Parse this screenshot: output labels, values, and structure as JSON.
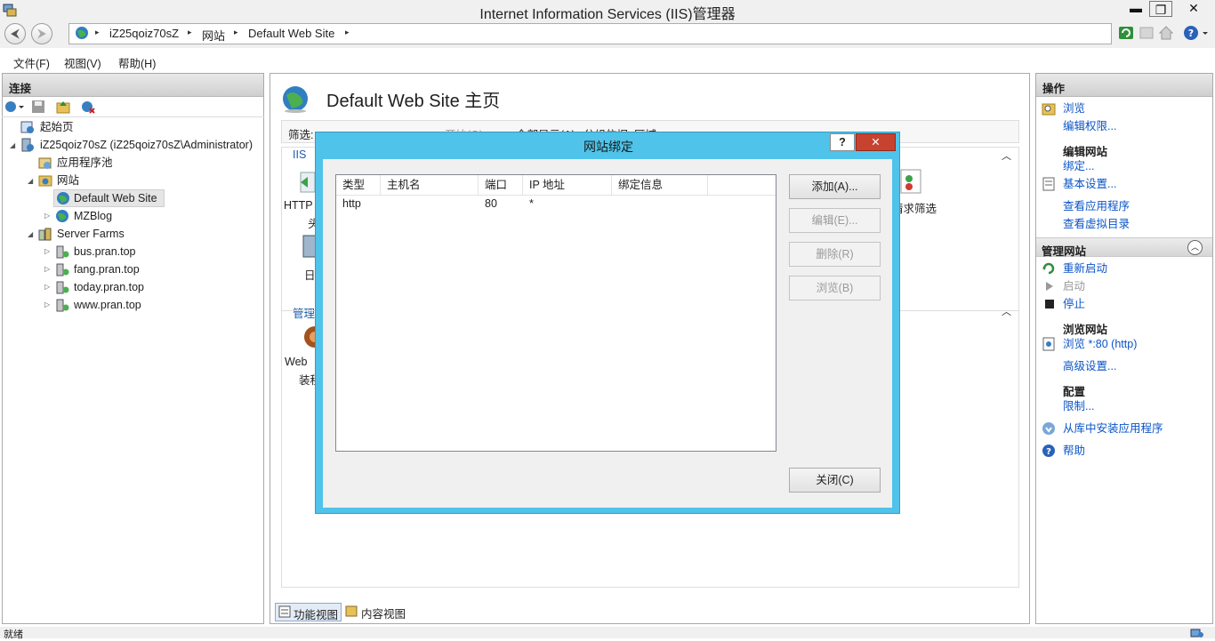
{
  "window": {
    "title": "Internet Information Services (IIS)管理器",
    "min": "▬",
    "max": "❐",
    "close": "✕"
  },
  "address": {
    "crumbs": [
      "iZ25qoiz70sZ",
      "网站",
      "Default Web Site"
    ],
    "sep": "▸"
  },
  "menu": [
    "文件(F)",
    "视图(V)",
    "帮助(H)"
  ],
  "connections": {
    "header": "连接",
    "tree": [
      {
        "label": "起始页",
        "icon": "start-page-icon"
      },
      {
        "label": "iZ25qoiz70sZ (iZ25qoiz70sZ\\Administrator)",
        "icon": "server-icon"
      },
      {
        "label": "应用程序池",
        "icon": "app-pools-icon"
      },
      {
        "label": "网站",
        "icon": "sites-folder-icon"
      },
      {
        "label": "Default Web Site",
        "icon": "globe-icon"
      },
      {
        "label": "MZBlog",
        "icon": "globe-icon"
      },
      {
        "label": "Server Farms",
        "icon": "server-farm-icon"
      },
      {
        "label": "bus.pran.top",
        "icon": "farm-node-icon"
      },
      {
        "label": "fang.pran.top",
        "icon": "farm-node-icon"
      },
      {
        "label": "today.pran.top",
        "icon": "farm-node-icon"
      },
      {
        "label": "www.pran.top",
        "icon": "farm-node-icon"
      }
    ]
  },
  "center": {
    "title": "Default Web Site 主页",
    "filter_label": "筛选:",
    "start": "开始(G)",
    "showall": "全部显示(A)",
    "groupby": "分组依据: 区域",
    "iis_group": "IIS",
    "manage_group": "管理",
    "feat_http": "HTTP",
    "feat_http2": "头",
    "feat_log": "日",
    "feat_web": "Web",
    "feat_web2": "装程",
    "feat_reqfilter": "请求筛选",
    "tabs": [
      "功能视图",
      "内容视图"
    ]
  },
  "dialog": {
    "title": "网站绑定",
    "help": "?",
    "close_x": "✕",
    "columns": [
      "类型",
      "主机名",
      "端口",
      "IP 地址",
      "绑定信息"
    ],
    "rows": [
      {
        "type": "http",
        "host": "",
        "port": "80",
        "ip": "*",
        "info": ""
      }
    ],
    "add": "添加(A)...",
    "edit": "编辑(E)...",
    "remove": "删除(R)",
    "browse": "浏览(B)",
    "close": "关闭(C)"
  },
  "actions": {
    "header": "操作",
    "browse": "浏览",
    "edit_perm": "编辑权限...",
    "edit_site": "编辑网站",
    "bindings": "绑定...",
    "basic": "基本设置...",
    "view_apps": "查看应用程序",
    "view_vdirs": "查看虚拟目录",
    "manage_site": "管理网站",
    "restart": "重新启动",
    "start": "启动",
    "stop": "停止",
    "browse_site": "浏览网站",
    "browse_80": "浏览 *:80 (http)",
    "advanced": "高级设置...",
    "config": "配置",
    "limits": "限制...",
    "install_gallery": "从库中安装应用程序",
    "help": "帮助"
  },
  "status": {
    "text": "就绪"
  }
}
